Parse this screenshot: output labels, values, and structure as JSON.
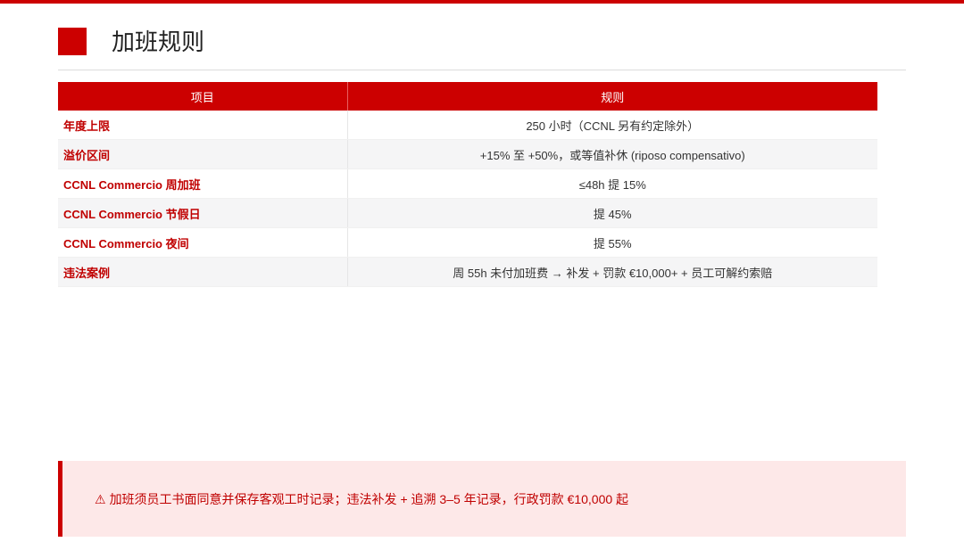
{
  "slide": {
    "title": "加班规则",
    "accent_color": "#cc0000"
  },
  "table": {
    "headers": [
      "项目",
      "规则"
    ],
    "rows": [
      {
        "item": "年度上限",
        "rule": "250 小时（CCNL 另有约定除外）"
      },
      {
        "item": "溢价区间",
        "rule": "+15% 至 +50%，或等值补休 (riposo compensativo)"
      },
      {
        "item": "CCNL Commercio 周加班",
        "rule": "≤48h 提 15%"
      },
      {
        "item": "CCNL Commercio 节假日",
        "rule": "提 45%"
      },
      {
        "item": "CCNL Commercio 夜间",
        "rule": "提 55%"
      },
      {
        "item": "违法案例",
        "rule": "周 55h 未付加班费 → 补发 + 罚款 €10,000+ + 员工可解约索赔"
      }
    ]
  },
  "note": {
    "icon": "warning-icon",
    "text": "加班须员工书面同意并保存客观工时记录；违法补发 + 追溯 3–5 年记录，行政罚款 €10,000 起"
  }
}
